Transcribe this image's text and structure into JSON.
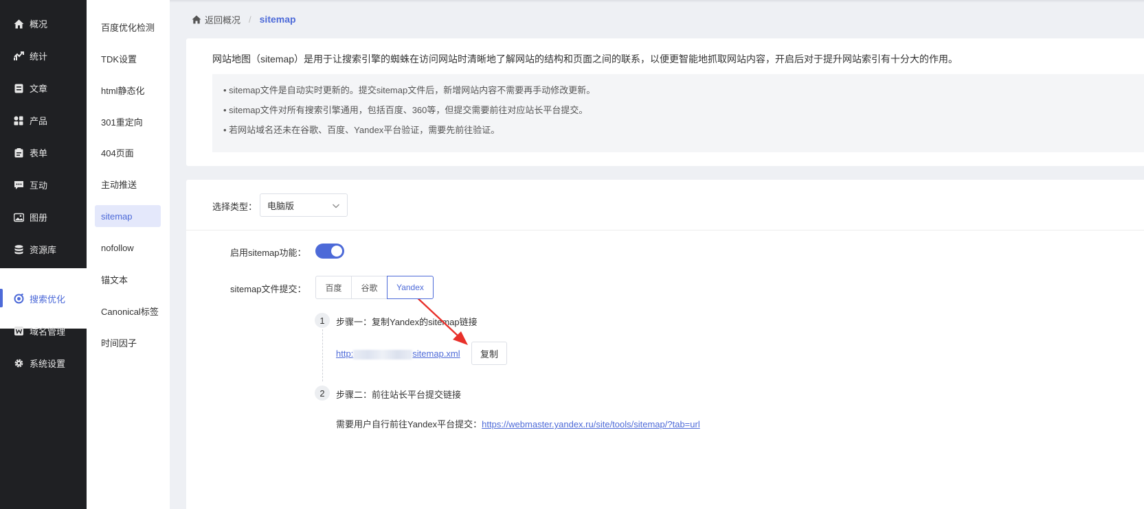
{
  "sidebar": {
    "items": [
      {
        "label": "概况",
        "icon": "home-icon"
      },
      {
        "label": "统计",
        "icon": "stats-icon"
      },
      {
        "label": "文章",
        "icon": "article-icon"
      },
      {
        "label": "产品",
        "icon": "grid-icon"
      },
      {
        "label": "表单",
        "icon": "clipboard-icon"
      },
      {
        "label": "互动",
        "icon": "chat-icon"
      },
      {
        "label": "图册",
        "icon": "gallery-icon"
      },
      {
        "label": "资源库",
        "icon": "database-icon"
      },
      {
        "label": "搜索优化",
        "icon": "seo-icon"
      },
      {
        "label": "域名管理",
        "icon": "domain-icon"
      },
      {
        "label": "系统设置",
        "icon": "gear-icon"
      }
    ],
    "active_index": 8
  },
  "subnav": {
    "items": [
      "百度优化检测",
      "TDK设置",
      "html静态化",
      "301重定向",
      "404页面",
      "主动推送",
      "sitemap",
      "nofollow",
      "锚文本",
      "Canonical标签",
      "时间因子"
    ],
    "active_index": 6
  },
  "breadcrumb": {
    "back": "返回概况",
    "separator": "/",
    "current": "sitemap"
  },
  "intro": {
    "lead": "网站地图（sitemap）是用于让搜索引擎的蜘蛛在访问网站时清晰地了解网站的结构和页面之间的联系，以便更智能地抓取网站内容，开启后对于提升网站索引有十分大的作用。",
    "tips": [
      "sitemap文件是自动实时更新的。提交sitemap文件后，新增网站内容不需要再手动修改更新。",
      "sitemap文件对所有搜索引擎通用，包括百度、360等，但提交需要前往对应站长平台提交。",
      "若网站域名还未在谷歌、百度、Yandex平台验证，需要先前往验证。"
    ]
  },
  "form": {
    "type_label": "选择类型：",
    "type_value": "电脑版",
    "enable_label": "启用sitemap功能：",
    "enabled": true,
    "submit_label": "sitemap文件提交：",
    "engines": [
      "百度",
      "谷歌",
      "Yandex"
    ],
    "engine_selected": "Yandex"
  },
  "steps": {
    "step1_num": "1",
    "step1_title": "步骤一：复制Yandex的sitemap链接",
    "link_prefix": "http:",
    "link_suffix": "sitemap.xml",
    "copy_label": "复制",
    "step2_num": "2",
    "step2_title": "步骤二：前往站长平台提交链接",
    "step2_desc": "需要用户自行前往Yandex平台提交：",
    "step2_url": "https://webmaster.yandex.ru/site/tools/sitemap/?tab=url"
  },
  "colors": {
    "accent": "#4d6ad8",
    "sidebar_bg": "#1f2023",
    "annotation_arrow": "#e8302a"
  }
}
